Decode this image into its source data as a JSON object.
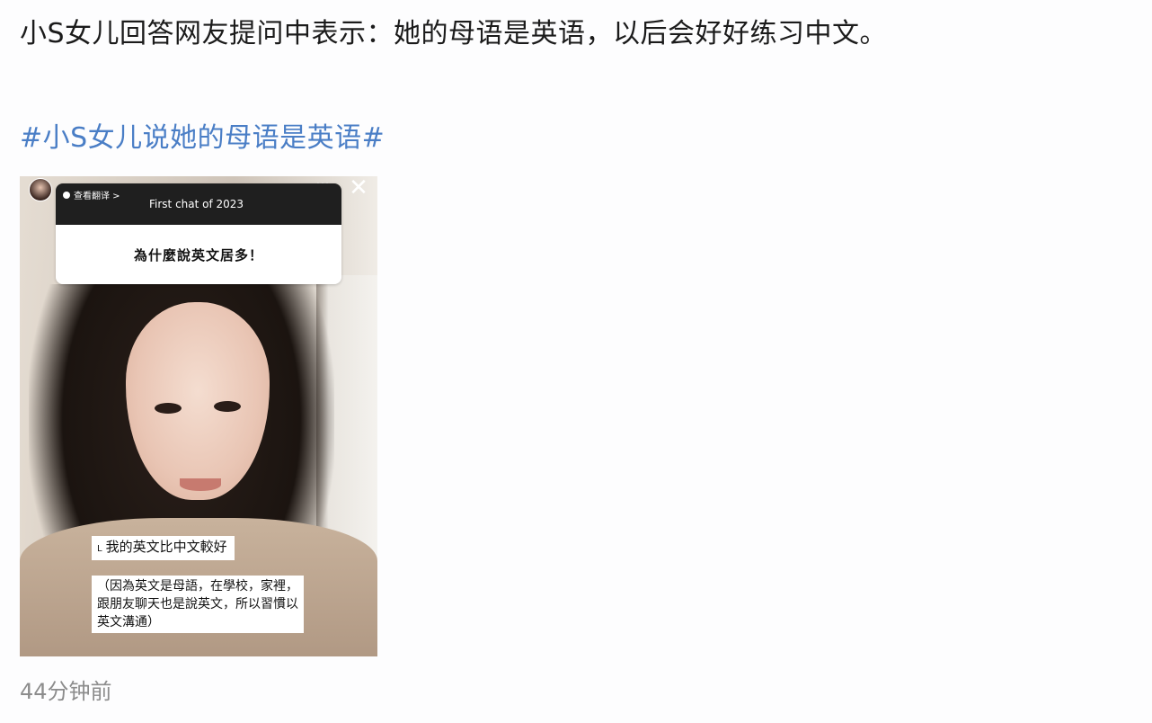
{
  "post": {
    "text": "小S女儿回答网友提问中表示：她的母语是英语，以后会好好练习中文。",
    "hashtag": "#小S女儿说她的母语是英语#",
    "timestamp": "44分钟前"
  },
  "story": {
    "translate_label": "查看翻译 >",
    "prompt": "First chat of 2023",
    "question": "為什麼說英文居多！",
    "more_glyph": "···",
    "close_glyph": "✕",
    "answer_line1_prefix": "L",
    "answer_line1": "我的英文比中文較好",
    "answer_line2": "（因為英文是母語，在學校，家裡，跟朋友聊天也是說英文，所以習慣以英文溝通）"
  }
}
